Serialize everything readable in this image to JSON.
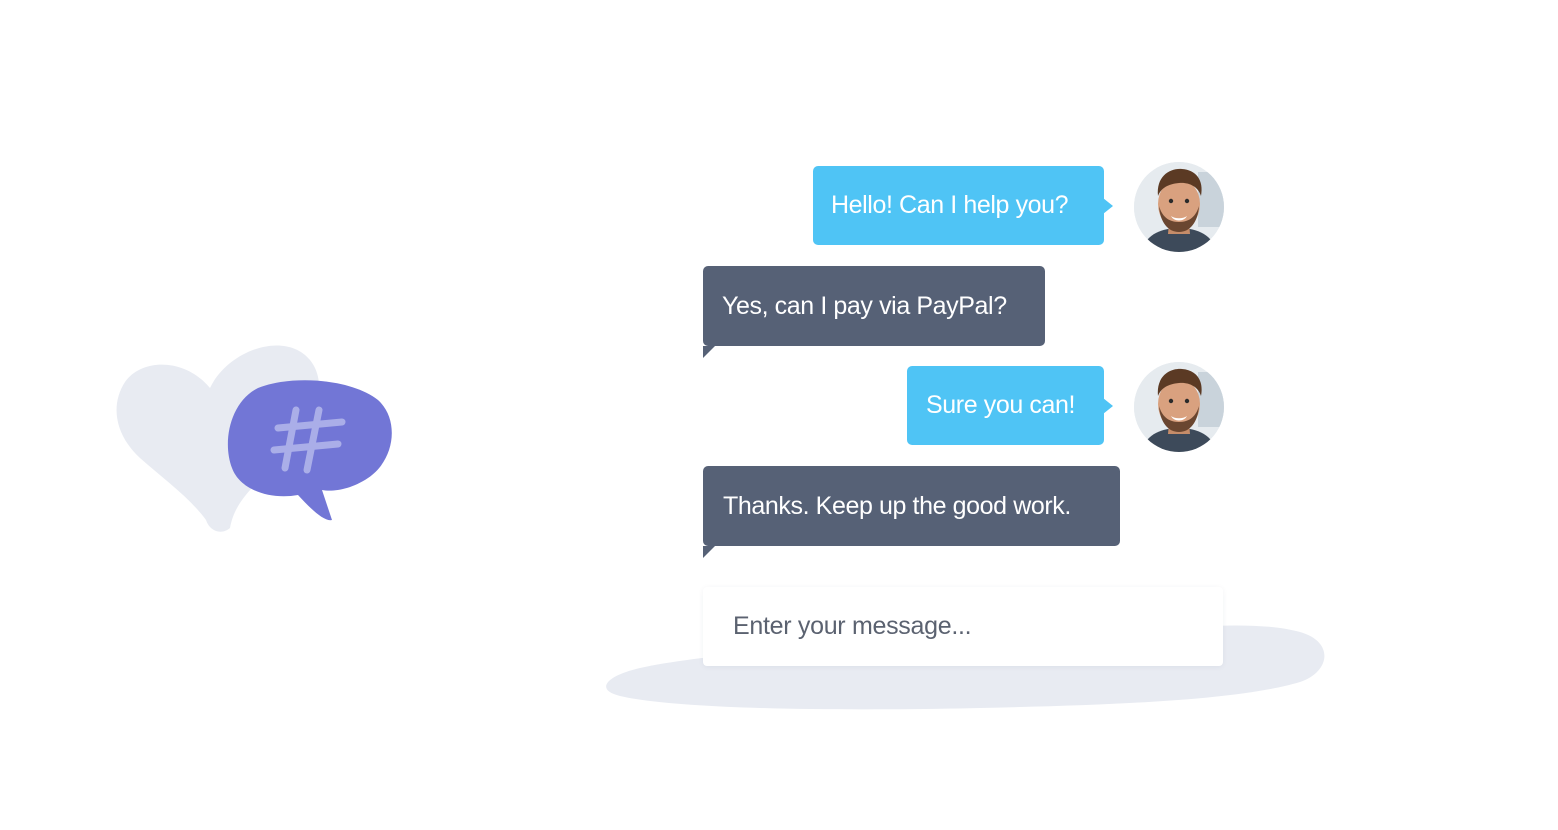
{
  "colors": {
    "agent_bubble": "#4fc4f5",
    "user_bubble": "#566176",
    "accent_purple": "#7276d6",
    "blob_gray": "#e8ebf2"
  },
  "decoration": {
    "icon": "hashtag-chat-bubble-icon",
    "background": "heart-shape"
  },
  "messages": [
    {
      "from": "agent",
      "text": "Hello! Can I help you?",
      "avatar": "agent-avatar"
    },
    {
      "from": "user",
      "text": "Yes, can I pay via PayPal?"
    },
    {
      "from": "agent",
      "text": "Sure you can!",
      "avatar": "agent-avatar"
    },
    {
      "from": "user",
      "text": "Thanks. Keep up the good work."
    }
  ],
  "composer": {
    "placeholder": "Enter your message..."
  }
}
